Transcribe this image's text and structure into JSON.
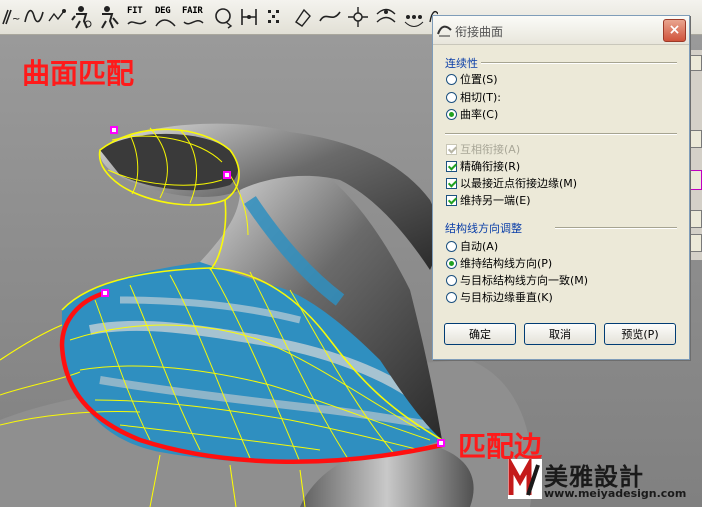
{
  "viewport": {
    "title_annotation": "曲面匹配",
    "edge_annotation": "匹配边"
  },
  "toolbar": {
    "fit_label": "FIT",
    "deg_label": "DEG",
    "fair_label": "FAIR",
    "icons": [
      "rebuild-curve-icon",
      "curve-edit-icon",
      "adjust-icon",
      "person-icon",
      "person-edit-icon",
      "fit-icon",
      "degree-icon",
      "fair-icon",
      "rotate-icon",
      "insert-knot-icon",
      "control-points-icon",
      "curve-pencil-icon",
      "curve-icon",
      "node-icon",
      "blend-icon",
      "dots-icon",
      "arc-icon"
    ]
  },
  "dialog": {
    "title": "衔接曲面",
    "close_label": "×",
    "continuity_header": "连续性",
    "continuity_options": [
      {
        "label": "位置(S)",
        "selected": false
      },
      {
        "label": "相切(T):",
        "selected": false
      },
      {
        "label": "曲率(C)",
        "selected": true
      }
    ],
    "checks": [
      {
        "label": "互相衔接(A)",
        "checked": true,
        "disabled": true
      },
      {
        "label": "精确衔接(R)",
        "checked": true,
        "disabled": false
      },
      {
        "label": "以最接近点衔接边缘(M)",
        "checked": true,
        "disabled": false
      },
      {
        "label": "维持另一端(E)",
        "checked": true,
        "disabled": false
      }
    ],
    "isoline_header": "结构线方向调整",
    "isoline_options": [
      {
        "label": "自动(A)",
        "selected": false
      },
      {
        "label": "维持结构线方向(P)",
        "selected": true
      },
      {
        "label": "与目标结构线方向一致(M)",
        "selected": false
      },
      {
        "label": "与目标边缘垂直(K)",
        "selected": false
      }
    ],
    "ok_label": "确定",
    "cancel_label": "取消",
    "preview_label": "预览(P)"
  },
  "watermark": {
    "title": "美雅設計",
    "url": "www.meiyadesign.com"
  },
  "colors": {
    "annotation_red": "#ff1a1a",
    "wire_yellow": "#ffff00",
    "surface_blue": "#2f8fc0",
    "dialog_bg": "#ece9d8",
    "header_blue": "#0a3ea8"
  }
}
